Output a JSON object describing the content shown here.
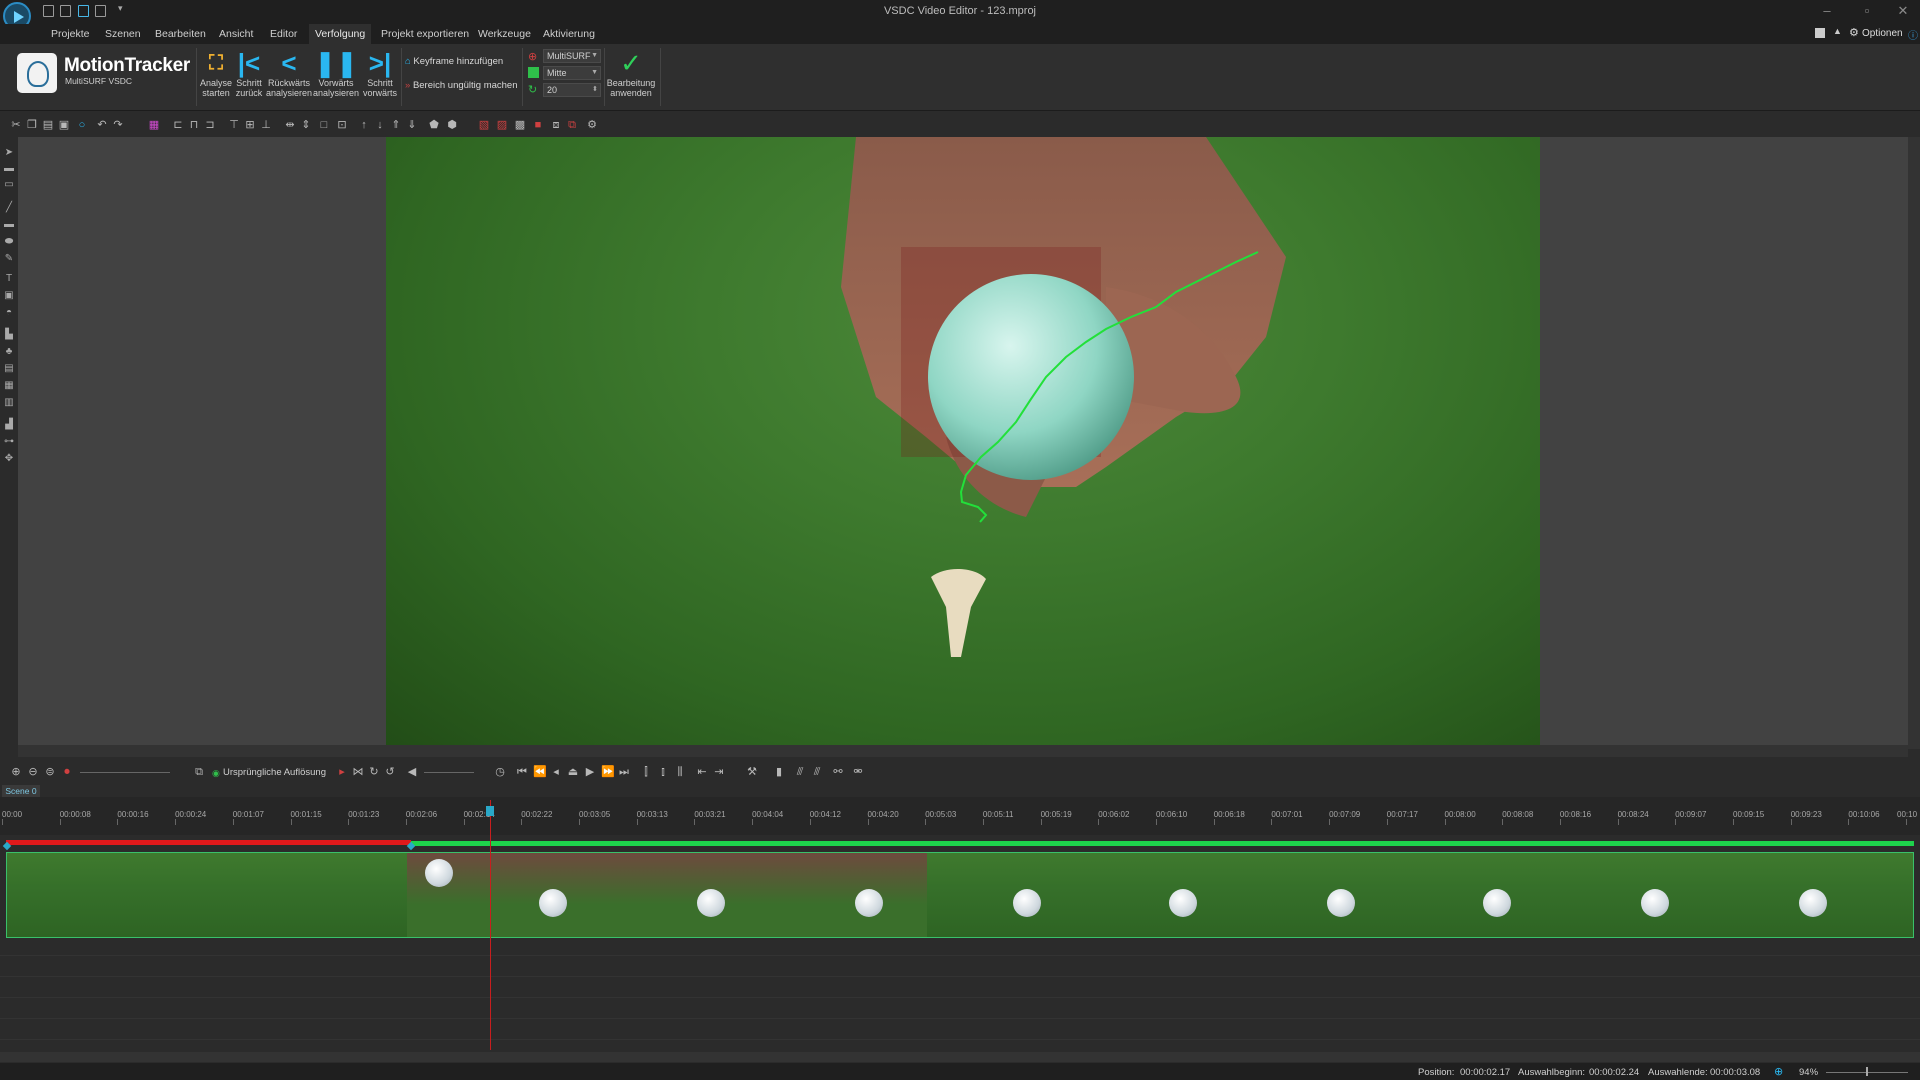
{
  "window": {
    "title": "VSDC Video Editor - 123.mproj"
  },
  "menu": {
    "items": [
      {
        "label": "Projekte"
      },
      {
        "label": "Szenen"
      },
      {
        "label": "Bearbeiten"
      },
      {
        "label": "Ansicht"
      },
      {
        "label": "Editor"
      },
      {
        "label": "Verfolgung"
      },
      {
        "label": "Projekt exportieren"
      },
      {
        "label": "Werkzeuge"
      },
      {
        "label": "Aktivierung"
      }
    ],
    "options_label": "Optionen"
  },
  "ribbon": {
    "product_title": "MotionTracker",
    "product_sub": "MultiSURF VSDC",
    "buttons": [
      {
        "line1": "Analyse",
        "line2": "starten",
        "icon": "analyse-icon"
      },
      {
        "line1": "Schritt",
        "line2": "zurück",
        "icon": "step-back-icon"
      },
      {
        "line1": "Rückwärts",
        "line2": "analysieren",
        "icon": "analyse-backward-icon"
      },
      {
        "line1": "Vorwärts",
        "line2": "analysieren",
        "icon": "pause-icon"
      },
      {
        "line1": "Schritt",
        "line2": "vorwärts",
        "icon": "step-forward-icon"
      }
    ],
    "keyframe_label": "Keyframe hinzufügen",
    "invalidate_label": "Bereich ungültig machen",
    "algorithm": "MultiSURF",
    "position": "Mitte",
    "value": "20",
    "apply_line1": "Bearbeitung",
    "apply_line2": "anwenden"
  },
  "timeline": {
    "resolution_label": "Ursprüngliche Auflösung",
    "scene_tab": "Scene 0",
    "ticks": [
      "00:00",
      "00:00:08",
      "00:00:16",
      "00:00:24",
      "00:01:07",
      "00:01:15",
      "00:01:23",
      "00:02:06",
      "00:02:14",
      "00:02:22",
      "00:03:05",
      "00:03:13",
      "00:03:21",
      "00:04:04",
      "00:04:12",
      "00:04:20",
      "00:05:03",
      "00:05:11",
      "00:05:19",
      "00:06:02",
      "00:06:10",
      "00:06:18",
      "00:07:01",
      "00:07:09",
      "00:07:17",
      "00:08:00",
      "00:08:08",
      "00:08:16",
      "00:08:24",
      "00:09:07",
      "00:09:15",
      "00:09:23",
      "00:10:06",
      "00:10"
    ]
  },
  "status": {
    "position_label": "Position:",
    "position_value": "00:00:02.17",
    "sel_start_label": "Auswahlbeginn:",
    "sel_start_value": "00:00:02.24",
    "sel_end_label": "Auswahlende:",
    "sel_end_value": "00:00:03.08",
    "zoom": "94%"
  },
  "colors": {
    "accent": "#2ab7f0",
    "track_red": "#e0191b",
    "track_green": "#1ed34c",
    "tracker_path": "#22e03a"
  }
}
